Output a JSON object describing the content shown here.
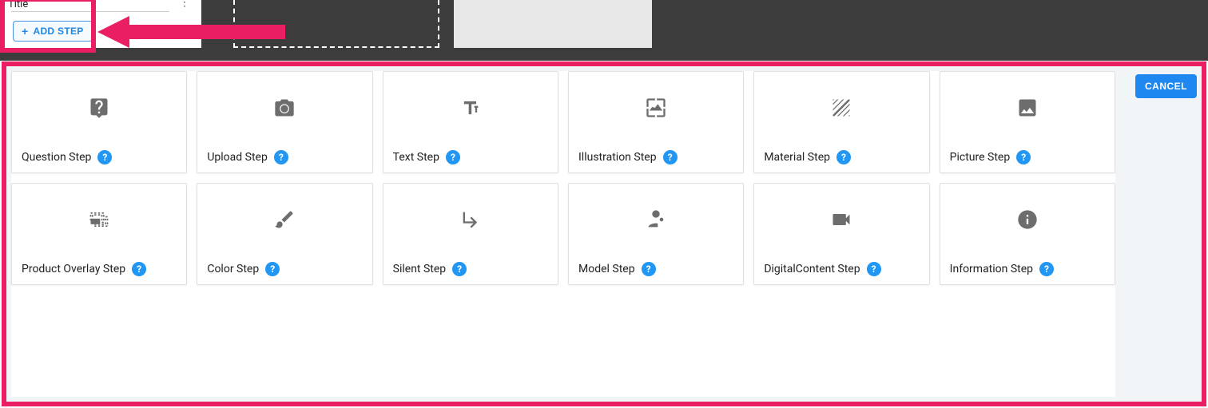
{
  "header": {
    "title_label": "Title",
    "add_step_label": "ADD STEP"
  },
  "panel": {
    "cancel_label": "CANCEL"
  },
  "steps": [
    {
      "id": "question",
      "label": "Question Step",
      "icon": "question"
    },
    {
      "id": "upload",
      "label": "Upload Step",
      "icon": "camera"
    },
    {
      "id": "text",
      "label": "Text Step",
      "icon": "text-tt"
    },
    {
      "id": "illustration",
      "label": "Illustration Step",
      "icon": "wallpaper"
    },
    {
      "id": "material",
      "label": "Material Step",
      "icon": "texture"
    },
    {
      "id": "picture",
      "label": "Picture Step",
      "icon": "image"
    },
    {
      "id": "product-overlay",
      "label": "Product Overlay Step",
      "icon": "overlay"
    },
    {
      "id": "color",
      "label": "Color Step",
      "icon": "brush"
    },
    {
      "id": "silent",
      "label": "Silent Step",
      "icon": "subdir"
    },
    {
      "id": "model",
      "label": "Model Step",
      "icon": "person-pin"
    },
    {
      "id": "digital-content",
      "label": "DigitalContent Step",
      "icon": "videocam"
    },
    {
      "id": "information",
      "label": "Information Step",
      "icon": "info"
    }
  ]
}
